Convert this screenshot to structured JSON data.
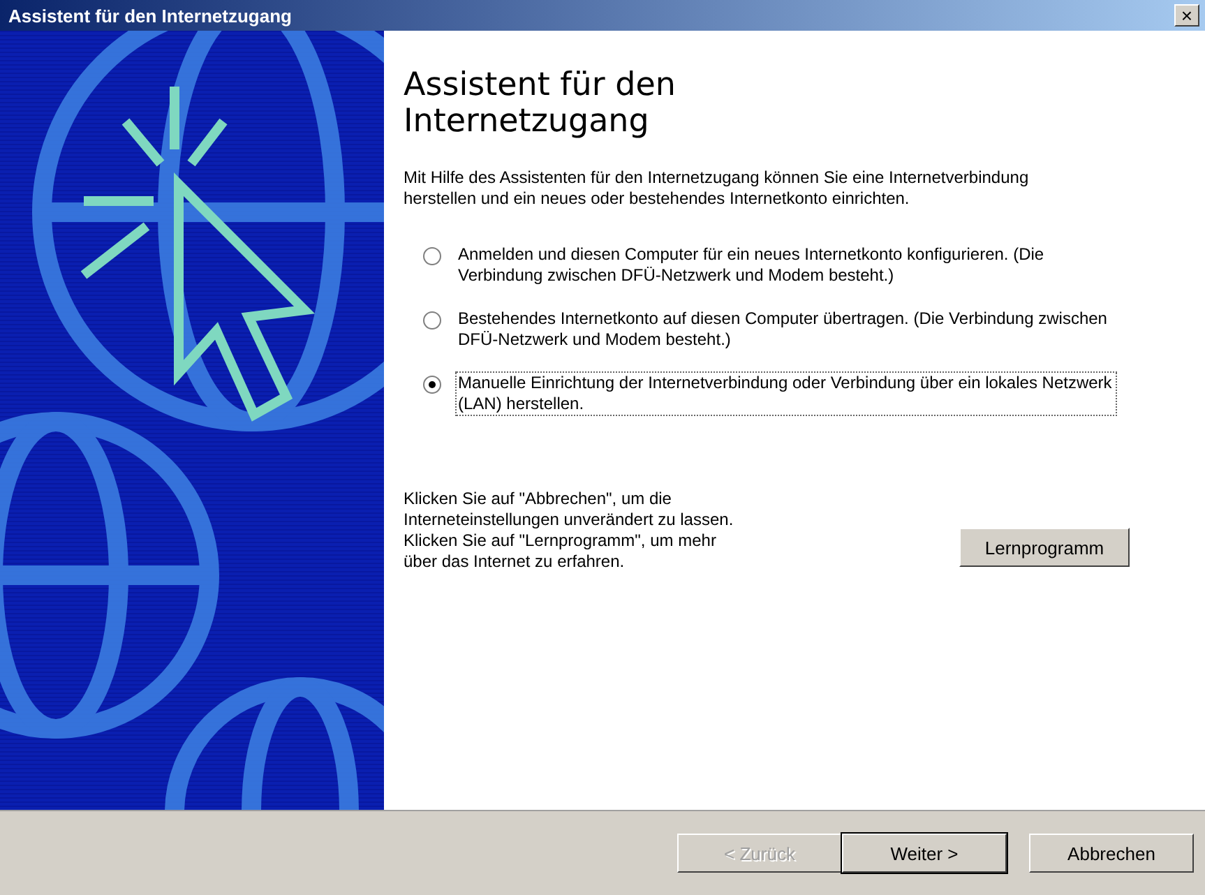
{
  "window": {
    "title": "Assistent für den Internetzugang",
    "close": "×"
  },
  "heading": "Assistent für den Internetzugang",
  "intro": "Mit Hilfe des Assistenten für den Internetzugang können Sie eine Internetverbindung herstellen und ein neues oder bestehendes Internetkonto einrichten.",
  "options": [
    {
      "label": "Anmelden und diesen Computer für ein neues Internetkonto konfigurieren. (Die Verbindung zwischen DFÜ-Netzwerk und Modem besteht.)",
      "selected": false
    },
    {
      "label": "Bestehendes Internetkonto auf diesen Computer übertragen. (Die Verbindung zwischen DFÜ-Netzwerk und Modem besteht.)",
      "selected": false
    },
    {
      "label": "Manuelle Einrichtung der Internetverbindung oder Verbindung über ein lokales Netzwerk (LAN) herstellen.",
      "selected": true
    }
  ],
  "hint_cancel": "Klicken Sie auf \"Abbrechen\", um die Interneteinstellungen unverändert zu lassen.",
  "hint_tutorial": "Klicken Sie auf \"Lernprogramm\", um mehr über das Internet zu erfahren.",
  "tutorial_button": "Lernprogramm",
  "buttons": [
    {
      "label": "< Zurück",
      "disabled": true,
      "default": false
    },
    {
      "label": "Weiter >",
      "disabled": false,
      "default": true
    },
    {
      "label": "Abbrechen",
      "disabled": false,
      "default": false
    }
  ]
}
